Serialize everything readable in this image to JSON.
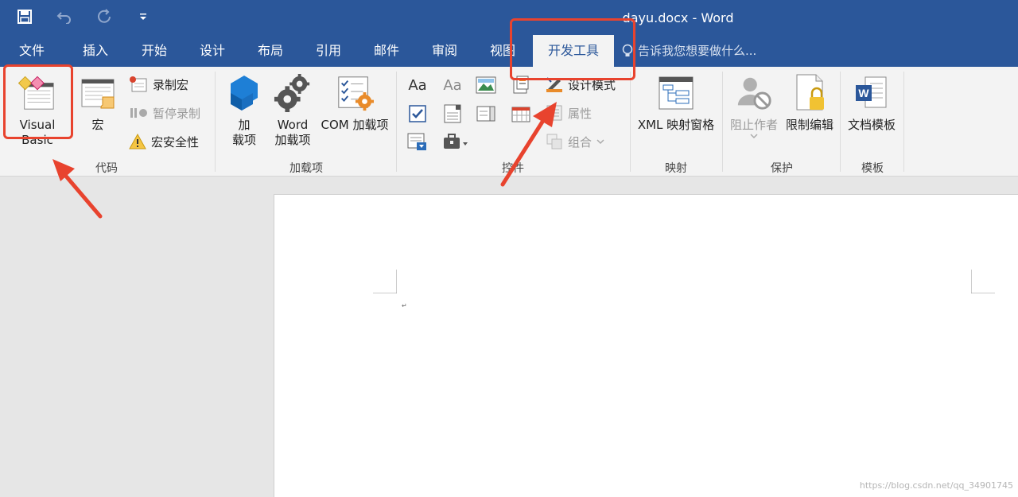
{
  "window": {
    "title": "dayu.docx - Word"
  },
  "qat": {
    "save": "save-icon",
    "undo": "undo-icon",
    "redo": "redo-icon",
    "customize": "dropdown-icon"
  },
  "tabs": [
    {
      "label": "文件"
    },
    {
      "label": "插入"
    },
    {
      "label": "开始"
    },
    {
      "label": "设计"
    },
    {
      "label": "布局"
    },
    {
      "label": "引用"
    },
    {
      "label": "邮件"
    },
    {
      "label": "审阅"
    },
    {
      "label": "视图"
    },
    {
      "label": "开发工具"
    }
  ],
  "tell_me": {
    "placeholder": "告诉我您想要做什么..."
  },
  "groups": {
    "code": {
      "label": "代码",
      "visual_basic": "Visual Basic",
      "macros": "宏",
      "record_macro": "录制宏",
      "pause_recording": "暂停录制",
      "macro_security": "宏安全性"
    },
    "addins": {
      "label": "加载项",
      "addins_line1": "加",
      "addins_line2": "载项",
      "word_addins_line1": "Word",
      "word_addins_line2": "加载项",
      "com_addins": "COM 加载项"
    },
    "controls": {
      "label": "控件",
      "design_mode": "设计模式",
      "properties": "属性",
      "group": "组合"
    },
    "mapping": {
      "label": "映射",
      "xml_pane": "XML 映射窗格"
    },
    "protect": {
      "label": "保护",
      "block_authors": "阻止作者",
      "restrict_editing": "限制编辑"
    },
    "templates": {
      "label": "模板",
      "document_template": "文档模板"
    }
  },
  "document": {
    "paragraph_mark": "↵"
  },
  "watermark": "https://blog.csdn.net/qq_34901745",
  "colors": {
    "accent": "#2b579a",
    "annotation": "#e8432e"
  }
}
